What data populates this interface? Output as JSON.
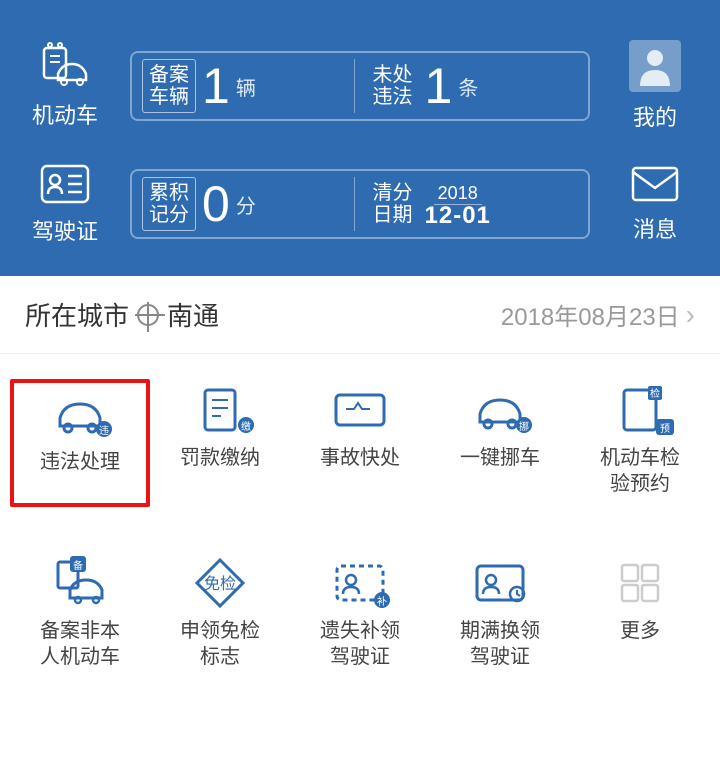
{
  "header": {
    "vehicle_label": "机动车",
    "license_label": "驾驶证",
    "profile_label": "我的",
    "messages_label": "消息",
    "card1": {
      "seg1_label": "备案\n车辆",
      "seg1_value": "1",
      "seg1_unit": "辆",
      "seg2_label": "未处\n违法",
      "seg2_value": "1",
      "seg2_unit": "条"
    },
    "card2": {
      "seg1_label": "累积\n记分",
      "seg1_value": "0",
      "seg1_unit": "分",
      "seg2_label": "清分\n日期",
      "date_year": "2018",
      "date_md": "12-01"
    }
  },
  "city_bar": {
    "label": "所在城市",
    "city": "南通",
    "date": "2018年08月23日"
  },
  "grid": [
    {
      "label": "违法处理",
      "icon": "car-violation",
      "badge": "违",
      "highlighted": true
    },
    {
      "label": "罚款缴纳",
      "icon": "receipt",
      "badge": "缴"
    },
    {
      "label": "事故快处",
      "icon": "accident",
      "badge": ""
    },
    {
      "label": "一键挪车",
      "icon": "move-car",
      "badge": "挪"
    },
    {
      "label": "机动车检\n验预约",
      "icon": "inspection",
      "badge": "检",
      "badge2": "预"
    },
    {
      "label": "备案非本\n人机动车",
      "icon": "register-car",
      "badge": "备"
    },
    {
      "label": "申领免检\n标志",
      "icon": "exempt",
      "badge": "免检"
    },
    {
      "label": "遗失补领\n驾驶证",
      "icon": "lost-license",
      "badge": "补"
    },
    {
      "label": "期满换领\n驾驶证",
      "icon": "renew-license",
      "badge": ""
    },
    {
      "label": "更多",
      "icon": "more",
      "badge": ""
    }
  ]
}
